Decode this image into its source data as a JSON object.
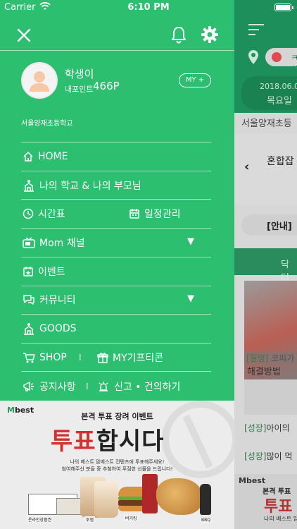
{
  "status_bar": {
    "carrier": "Carrier",
    "time": "6:10 PM"
  },
  "drawer": {
    "profile": {
      "name": "학생이",
      "point_label": "내포인트",
      "point_value": "466P",
      "my_button": "MY +",
      "school": "서울양재초등학교"
    },
    "menu": {
      "home": "HOME",
      "my_school": "나의 학교 & 나의 부모님",
      "timetable": "시간표",
      "schedule": "일정관리",
      "mom_channel": "Mom 채널",
      "event": "이벤트",
      "community": "커뮤니티",
      "goods": "GOODS",
      "shop": "SHOP",
      "divider": "I",
      "gifticon": "MY기프티콘",
      "notice": "공지사항",
      "report": "신고 • 건의하기",
      "expand_arrow": "▼"
    },
    "icons": [
      "close-icon",
      "bell-icon",
      "gear-icon",
      "home-icon",
      "school-icon",
      "clock-icon",
      "calendar-icon",
      "tv-icon",
      "event-icon",
      "chat-icon",
      "goods-icon",
      "cart-icon",
      "gift-icon",
      "megaphone-icon",
      "siren-icon"
    ]
  },
  "banner": {
    "logo_m": "M",
    "logo_rest": "best",
    "event_title": "본격 투표 장려 이벤트",
    "headline_red": "투표",
    "headline_black": "합시다",
    "desc_line1": "나의 베스트 맘베스트 컨텐츠에 투표해주세요!",
    "desc_line2": "참여해주신 분들 중 추첨하여 푸짐한 선물을 드립니다!",
    "prize_labels": [
      "온라인상품권",
      "투썸",
      "버거킹",
      "BBQ"
    ]
  },
  "background": {
    "search_text": "ㅋ 화",
    "date": "2018.06.0",
    "weekday": "목요일",
    "school": "서울양재초등",
    "back_arrow": "‹",
    "title": "혼합잡",
    "notice": "[안내]",
    "tab": "닥터",
    "card_tag": "[질병]",
    "card_tag_rest": " 코피가",
    "card_title": "해결방법",
    "list": [
      {
        "tag": "[성장]",
        "text": "아이의"
      },
      {
        "tag": "[성장]",
        "text": "많이 먹"
      }
    ],
    "banner_logo": "Mbest",
    "banner_text": "본격 투표",
    "banner_big": "투표",
    "banner_sub": "나의 베스트 맘"
  },
  "colors": {
    "drawer_green": "#2cbf6f",
    "header_dark_green": "#1c8f5a",
    "headline_red": "#d42e2e"
  }
}
